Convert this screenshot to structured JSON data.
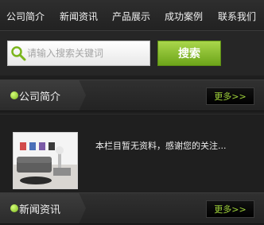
{
  "nav": {
    "items": [
      {
        "label": "公司简介"
      },
      {
        "label": "新闻资讯"
      },
      {
        "label": "产品展示"
      },
      {
        "label": "成功案例"
      },
      {
        "label": "联系我们"
      }
    ]
  },
  "search": {
    "placeholder": "请输入搜索关键词",
    "button_label": "搜索"
  },
  "sections": [
    {
      "title": "公司简介",
      "more_label": "更多>>"
    },
    {
      "title": "新闻资讯",
      "more_label": "更多>>"
    }
  ],
  "intro": {
    "text": "本栏目暂无资料，感谢您的关注..."
  },
  "colors": {
    "accent": "#7bb51c",
    "background": "#1e1e1e"
  }
}
